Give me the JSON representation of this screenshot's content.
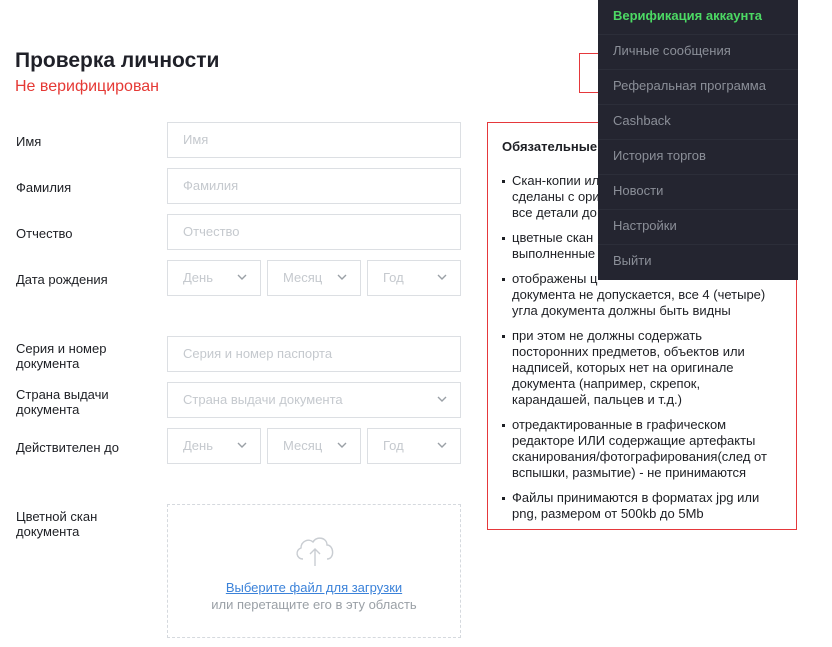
{
  "page": {
    "title": "Проверка личности",
    "status": "Не верифицирован"
  },
  "form": {
    "first_name": {
      "label": "Имя",
      "placeholder": "Имя"
    },
    "last_name": {
      "label": "Фамилия",
      "placeholder": "Фамилия"
    },
    "middle_name": {
      "label": "Отчество",
      "placeholder": "Отчество"
    },
    "birth_date": {
      "label": "Дата рождения",
      "day": "День",
      "month": "Месяц",
      "year": "Год"
    },
    "doc_number": {
      "label_line1": "Серия и номер",
      "label_line2": "документа",
      "placeholder": "Серия и номер паспорта"
    },
    "issue_country": {
      "label_line1": "Страна выдачи",
      "label_line2": "документа",
      "placeholder": "Страна выдачи документа"
    },
    "valid_until": {
      "label": "Действителен до",
      "day": "День",
      "month": "Месяц",
      "year": "Год"
    },
    "scan": {
      "label_line1": "Цветной скан",
      "label_line2": "документа",
      "link": "Выберите файл для загрузки",
      "hint": "или перетащите его в эту область"
    }
  },
  "requirements": {
    "title": "Обязательные",
    "items": [
      {
        "line1": "Скан-копии ил",
        "line2": "сделаны с ори",
        "line3": "все детали до"
      },
      {
        "line1": "цветные скан",
        "line2": "выполненные"
      },
      {
        "line1": "отображены ц",
        "line2": "документа не допускается, все 4 (четыре)",
        "line3": "угла документа должны быть видны"
      },
      {
        "line1": "при этом не должны содержать",
        "line2": "посторонних предметов, объектов или",
        "line3": "надписей, которых нет на оригинале",
        "line4": "документа (например, скрепок,",
        "line5": "карандашей, пальцев и т.д.)"
      },
      {
        "line1": "отредактированные в графическом",
        "line2": "редакторе ИЛИ содержащие артефакты",
        "line3": "сканирования/фотографирования(след от",
        "line4": "вспышки, размытие) - не принимаются"
      },
      {
        "line1": "Файлы принимаются в форматах jpg или",
        "line2": "png, размером от 500kb до 5Mb"
      }
    ]
  },
  "menu": {
    "items": [
      {
        "label": "Верификация аккаунта"
      },
      {
        "label": "Личные сообщения"
      },
      {
        "label": "Реферальная программа"
      },
      {
        "label": "Cashback"
      },
      {
        "label": "История торгов"
      },
      {
        "label": "Новости"
      },
      {
        "label": "Настройки"
      },
      {
        "label": "Выйти"
      }
    ],
    "active_color": "#4cd964",
    "background": "#242530"
  },
  "colors": {
    "accent_red": "#e53935",
    "link_blue": "#3b82d9"
  }
}
